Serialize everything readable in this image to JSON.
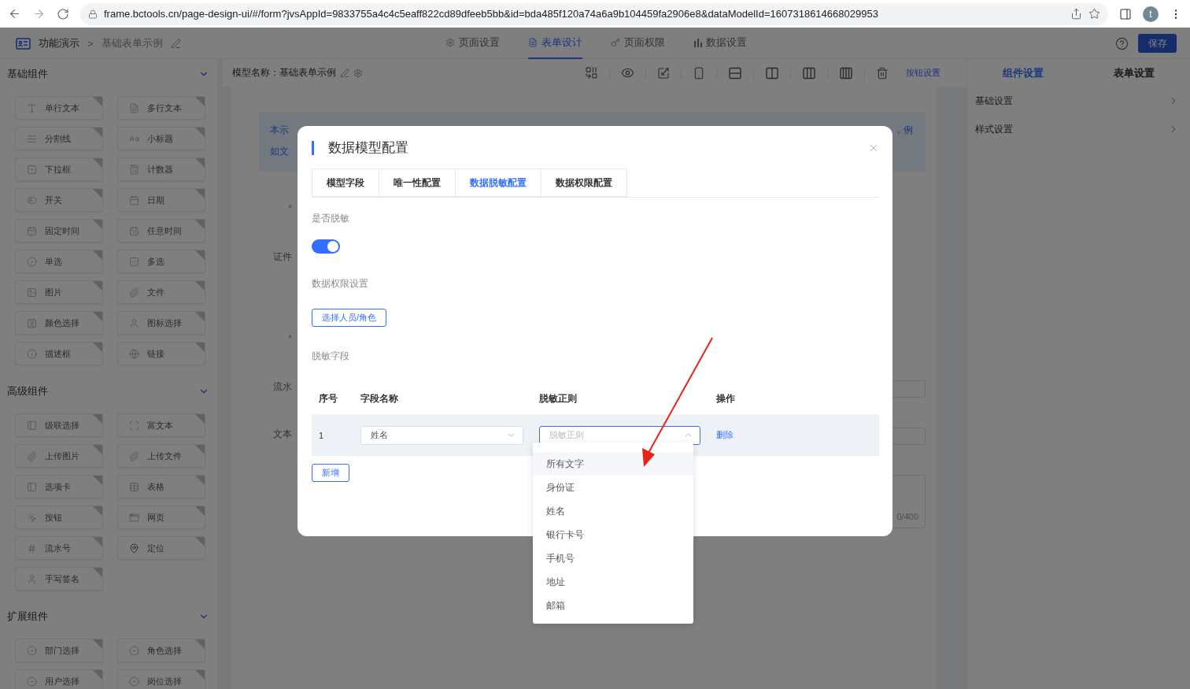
{
  "browser": {
    "url": "frame.bctools.cn/page-design-ui/#/form?jvsAppId=9833755a4c4c5eaff822cd89dfeeb5bb&id=bda485f120a74a6a9b104459fa2906e8&dataModelId=1607318614668029953",
    "avatar": "t"
  },
  "header": {
    "breadcrumb": [
      "功能演示",
      "基础表单示例"
    ],
    "separator": ">",
    "tabs": [
      {
        "label": "页面设置",
        "selected": false
      },
      {
        "label": "表单设计",
        "selected": true
      },
      {
        "label": "页面权限",
        "selected": false
      },
      {
        "label": "数据设置",
        "selected": false
      }
    ],
    "save": "保存"
  },
  "sidebar": {
    "sections": [
      {
        "title": "基础组件",
        "expanded": true,
        "items": [
          "单行文本",
          "多行文本",
          "分割线",
          "小标题",
          "下拉框",
          "计数器",
          "开关",
          "日期",
          "固定时间",
          "任意时间",
          "单选",
          "多选",
          "图片",
          "文件",
          "颜色选择",
          "图标选择",
          "描述框",
          "链接"
        ]
      },
      {
        "title": "高级组件",
        "expanded": true,
        "items": [
          "级联选择",
          "富文本",
          "上传图片",
          "上传文件",
          "选项卡",
          "表格",
          "按钮",
          "网页",
          "流水号",
          "定位",
          "手写签名"
        ]
      },
      {
        "title": "扩展组件",
        "expanded": true,
        "items": [
          "部门选择",
          "角色选择",
          "用户选择",
          "岗位选择"
        ]
      }
    ]
  },
  "toolbar": {
    "model_name": "模型名称：基础表单示例",
    "button_settings": "按钮设置"
  },
  "canvas": {
    "info": {
      "lines": [
        "本示",
        "如文"
      ],
      "end": "，例"
    },
    "fields": [
      {
        "kind": "plain",
        "label": "*"
      },
      {
        "kind": "tall",
        "label": "证件"
      },
      {
        "kind": "plain",
        "label": "*"
      },
      {
        "kind": "input",
        "label": "流水"
      },
      {
        "kind": "input",
        "label": "文本"
      },
      {
        "kind": "textarea",
        "counter": "0/400"
      }
    ]
  },
  "right_panel": {
    "tabs": [
      {
        "label": "组件设置",
        "selected": true
      },
      {
        "label": "表单设置",
        "selected": false
      }
    ],
    "items": [
      "基础设置",
      "样式设置"
    ]
  },
  "modal": {
    "title": "数据模型配置",
    "tabs": [
      {
        "label": "模型字段",
        "selected": false
      },
      {
        "label": "唯一性配置",
        "selected": false
      },
      {
        "label": "数据脱敏配置",
        "selected": true
      },
      {
        "label": "数据权限配置",
        "selected": false
      }
    ],
    "mask_label": "是否脱敏",
    "mask_switch": {
      "on": true
    },
    "permission_label": "数据权限设置",
    "permission_button": "选择人员/角色",
    "fields_label": "脱敏字段",
    "table": {
      "columns": [
        "序号",
        "字段名称",
        "脱敏正则",
        "操作"
      ],
      "rows": [
        {
          "index": "1",
          "field": {
            "value": "姓名",
            "open": false
          },
          "rule": {
            "placeholder": "脱敏正则",
            "open": true,
            "options": [
              {
                "label": "所有文字",
                "highlighted": true
              },
              {
                "label": "身份证",
                "highlighted": false
              },
              {
                "label": "姓名",
                "highlighted": false
              },
              {
                "label": "银行卡号",
                "highlighted": false
              },
              {
                "label": "手机号",
                "highlighted": false
              },
              {
                "label": "地址",
                "highlighted": false
              },
              {
                "label": "邮箱",
                "highlighted": false
              }
            ]
          },
          "action": "删除"
        }
      ]
    },
    "add_button": "新增"
  }
}
